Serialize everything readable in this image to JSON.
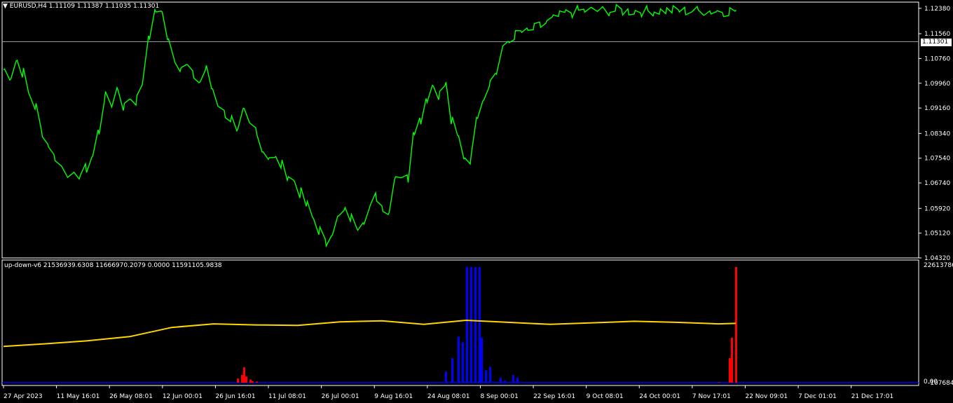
{
  "colors": {
    "background": "#000000",
    "grid_border": "#ffffff",
    "price_line": "#00ff00",
    "ma_line": "#ffd700",
    "up_hist": "#0000ff",
    "down_hist": "#ff0000",
    "baseline": "#0000ff"
  },
  "chart_header": {
    "dropdown_icon": "triangle-down-icon",
    "symbol": "EURUSD,H4",
    "ohlc": "1.11109 1.11387 1.11035 1.11301"
  },
  "current_price": "1.11301",
  "indicator_header": "up-down-v6 21536939.6308 11666970.2079 0.0000 11591105.9838",
  "indicator_axis": {
    "top": "22613786.",
    "bottom_a": "0.00",
    "bottom_b": "-1076846."
  },
  "chart_data": [
    {
      "type": "line",
      "name": "EURUSD,H4",
      "y_ticks": [
        "1.12380",
        "1.11560",
        "1.10760",
        "1.09960",
        "1.09160",
        "1.08340",
        "1.07540",
        "1.06740",
        "1.05920",
        "1.05120",
        "1.04320"
      ],
      "y_tick_values": [
        1.1238,
        1.1156,
        1.1076,
        1.0996,
        1.0916,
        1.0834,
        1.0754,
        1.0674,
        1.0592,
        1.0512,
        1.0432
      ],
      "ylim": [
        1.0432,
        1.1258
      ],
      "x_labels": [
        "27 Apr 2023",
        "11 May 16:01",
        "26 May 08:01",
        "12 Jun 00:01",
        "26 Jun 16:01",
        "11 Jul 08:01",
        "26 Jul 00:01",
        "9 Aug 16:01",
        "24 Aug 08:01",
        "8 Sep 00:01",
        "22 Sep 16:01",
        "9 Oct 08:01",
        "24 Oct 00:01",
        "7 Nov 17:01",
        "22 Nov 09:01",
        "7 Dec 01:01",
        "21 Dec 17:01"
      ],
      "x": [
        0,
        3,
        6,
        9,
        12,
        15,
        18,
        21,
        24,
        27,
        30,
        33,
        36,
        39,
        42,
        45,
        48,
        51,
        54,
        57,
        60,
        63,
        66,
        69,
        72,
        75,
        78,
        81,
        84,
        87,
        90,
        93,
        96,
        99,
        102,
        105,
        108,
        111,
        114,
        117,
        120,
        123,
        126,
        129,
        132,
        135,
        138,
        141,
        144,
        147,
        150,
        153,
        156,
        159,
        162,
        165,
        168,
        171,
        174,
        177,
        180,
        183,
        186,
        189,
        192,
        195,
        198,
        201,
        204,
        207,
        210,
        213,
        216,
        219,
        222,
        225,
        228,
        231,
        234,
        237,
        240,
        243,
        246,
        249,
        252,
        255,
        258,
        261,
        264,
        267,
        270,
        273,
        276,
        279,
        282,
        285,
        288,
        291,
        294,
        297,
        300,
        303,
        306,
        309,
        312,
        315,
        318,
        321,
        324,
        327,
        330,
        333,
        336,
        339,
        342,
        345,
        348
      ],
      "values": [
        1.104,
        1.102,
        1.107,
        1.103,
        1.096,
        1.092,
        1.084,
        1.08,
        1.076,
        1.073,
        1.071,
        1.069,
        1.07,
        1.072,
        1.076,
        1.084,
        1.095,
        1.093,
        1.098,
        1.092,
        1.095,
        1.094,
        1.1,
        1.115,
        1.123,
        1.122,
        1.115,
        1.108,
        1.105,
        1.105,
        1.102,
        1.1,
        1.104,
        1.098,
        1.093,
        1.09,
        1.088,
        1.083,
        1.09,
        1.086,
        1.085,
        1.078,
        1.076,
        1.075,
        1.073,
        1.07,
        1.068,
        1.064,
        1.06,
        1.056,
        1.052,
        1.048,
        1.052,
        1.056,
        1.058,
        1.056,
        1.054,
        1.056,
        1.059,
        1.063,
        1.06,
        1.058,
        1.07,
        1.07,
        1.069,
        1.085,
        1.088,
        1.095,
        1.099,
        1.096,
        1.099,
        1.087,
        1.082,
        1.076,
        1.075,
        1.09,
        1.095,
        1.1,
        1.103,
        1.11,
        1.113,
        1.115,
        1.116,
        1.116,
        1.117,
        1.118,
        1.119,
        1.12,
        1.121,
        1.122,
        1.1225,
        1.123,
        1.123,
        1.123,
        1.123,
        1.123,
        1.123,
        1.123,
        1.123,
        1.123,
        1.123,
        1.123,
        1.123,
        1.123,
        1.123,
        1.123,
        1.123,
        1.123,
        1.123,
        1.123,
        1.123,
        1.123,
        1.123,
        1.123,
        1.123,
        1.123,
        1.123
      ]
    },
    {
      "type": "line",
      "name": "up-down-v6",
      "ylim": [
        0,
        22613786
      ],
      "series": [
        {
          "x": [
            0,
            20,
            40,
            60,
            80,
            100,
            120,
            140,
            160,
            180,
            200,
            220,
            240,
            260,
            280,
            300,
            320,
            340,
            349
          ],
          "values": [
            7100000,
            7600000,
            8200000,
            9000000,
            10800000,
            11500000,
            11300000,
            11200000,
            11900000,
            12100000,
            11400000,
            12200000,
            11800000,
            11400000,
            11700000,
            12000000,
            11800000,
            11500000,
            11600000
          ]
        }
      ]
    },
    {
      "type": "bar",
      "name": "up-down-v6 histograms",
      "series": [
        {
          "color": "down",
          "x": [
            111,
            113,
            114,
            115,
            117,
            118,
            120,
            340,
            345,
            346,
            348,
            349
          ],
          "values": [
            800000,
            1500000,
            3000000,
            1200000,
            600000,
            300000,
            200000,
            100000,
            4800000,
            8800000,
            22613786,
            0
          ]
        },
        {
          "color": "up",
          "x": [
            210,
            213,
            216,
            218,
            220,
            222,
            224,
            226,
            227,
            229,
            231,
            236,
            238,
            242,
            244
          ],
          "values": [
            2200000,
            4800000,
            9000000,
            7900000,
            22613786,
            22613786,
            22613786,
            22613786,
            8800000,
            2400000,
            3100000,
            1000000,
            400000,
            1500000,
            1000000
          ]
        }
      ]
    }
  ]
}
